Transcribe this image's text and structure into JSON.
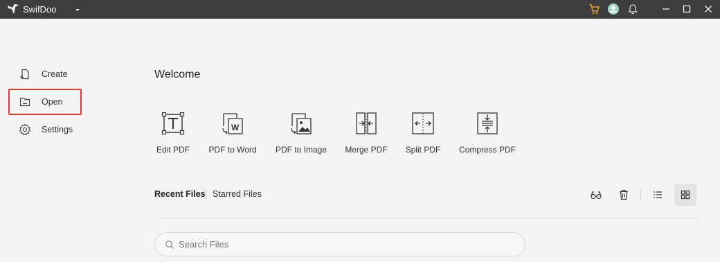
{
  "titlebar": {
    "app_name": "SwifDoo",
    "bg_color": "#3d3d3d",
    "icons": [
      "cart-icon",
      "user-icon",
      "bell-icon",
      "minimize-icon",
      "maximize-icon",
      "close-icon"
    ],
    "cart_color": "#f0a020"
  },
  "sidebar": {
    "items": [
      {
        "label": "Create",
        "icon": "create-icon"
      },
      {
        "label": "Open",
        "icon": "folder-icon",
        "selected": true,
        "highlight_color": "#e53935"
      },
      {
        "label": "Settings",
        "icon": "gear-icon"
      }
    ]
  },
  "main": {
    "welcome": "Welcome",
    "tools": [
      {
        "label": "Edit PDF",
        "icon": "edit-pdf-icon"
      },
      {
        "label": "PDF to Word",
        "icon": "pdf-to-word-icon"
      },
      {
        "label": "PDF to Image",
        "icon": "pdf-to-image-icon"
      },
      {
        "label": "Merge PDF",
        "icon": "merge-pdf-icon"
      },
      {
        "label": "Split PDF",
        "icon": "split-pdf-icon"
      },
      {
        "label": "Compress PDF",
        "icon": "compress-pdf-icon"
      }
    ]
  },
  "files": {
    "tabs": {
      "recent": "Recent Files",
      "starred": "Starred Files"
    },
    "active_tab": "Recent Files",
    "actions": [
      "glasses-icon",
      "trash-icon",
      "list-view-icon",
      "grid-view-icon"
    ],
    "view": "grid",
    "search": {
      "placeholder": "Search Files",
      "value": ""
    }
  }
}
